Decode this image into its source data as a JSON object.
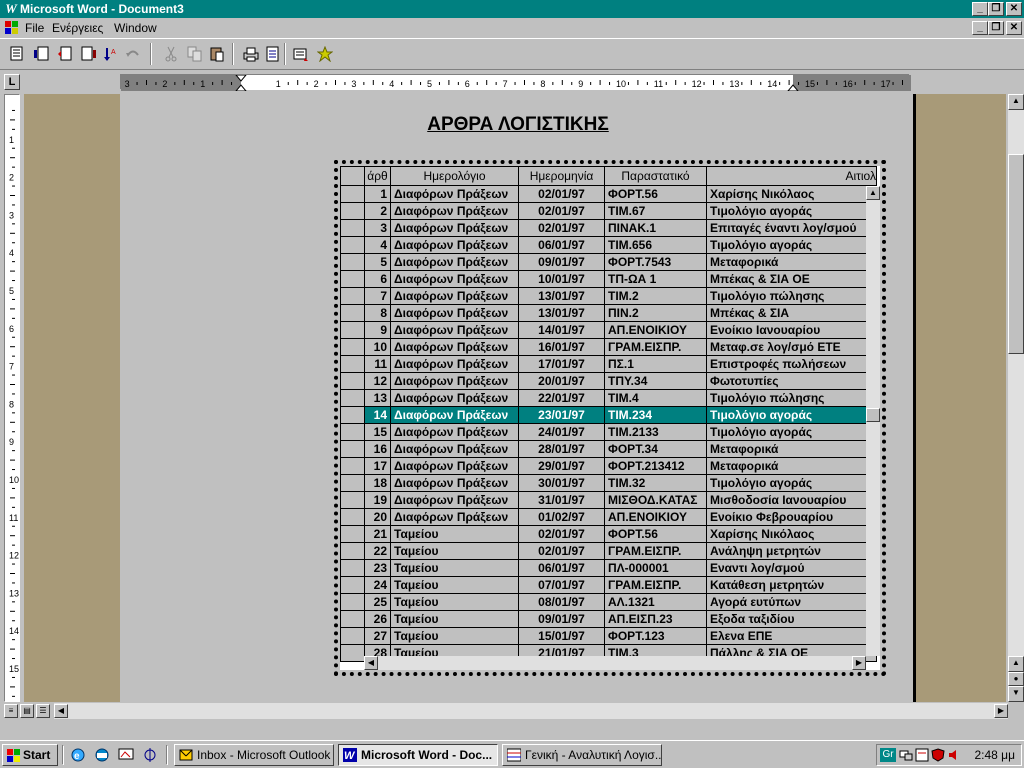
{
  "window": {
    "title": "Microsoft Word - Document3",
    "menu": [
      "File",
      "Ενέργειες",
      "Window"
    ]
  },
  "ruler": {
    "numbers": [
      "3",
      "2",
      "1",
      "1",
      "2",
      "3",
      "4",
      "5",
      "6",
      "7",
      "8",
      "9",
      "10",
      "11",
      "12",
      "13",
      "14",
      "15",
      "16",
      "17"
    ]
  },
  "document": {
    "title": "ΑΡΘΡΑ ΛΟΓΙΣΤΙΚΗΣ"
  },
  "grid": {
    "columns": [
      "άρθ",
      "Ημερολόγιο",
      "Ημερομηνία",
      "Παραστατικό",
      "Αιτιολ"
    ],
    "selected_row": 14,
    "rows": [
      {
        "n": "1",
        "journal": "Διαφόρων Πράξεων",
        "date": "02/01/97",
        "doc": "ΦΟΡΤ.56",
        "reason": "Χαρίσης Νικόλαος"
      },
      {
        "n": "2",
        "journal": "Διαφόρων Πράξεων",
        "date": "02/01/97",
        "doc": "ΤΙΜ.67",
        "reason": "Τιμολόγιο αγοράς"
      },
      {
        "n": "3",
        "journal": "Διαφόρων Πράξεων",
        "date": "02/01/97",
        "doc": "ΠΙΝΑΚ.1",
        "reason": "Επιταγές έναντι λογ/σμού"
      },
      {
        "n": "4",
        "journal": "Διαφόρων Πράξεων",
        "date": "06/01/97",
        "doc": "ΤΙΜ.656",
        "reason": "Τιμολόγιο αγοράς"
      },
      {
        "n": "5",
        "journal": "Διαφόρων Πράξεων",
        "date": "09/01/97",
        "doc": "ΦΟΡΤ.7543",
        "reason": "Μεταφορικά"
      },
      {
        "n": "6",
        "journal": "Διαφόρων Πράξεων",
        "date": "10/01/97",
        "doc": "ΤΠ-ΩΑ 1",
        "reason": "Μπέκας & ΣΙΑ ΟΕ"
      },
      {
        "n": "7",
        "journal": "Διαφόρων Πράξεων",
        "date": "13/01/97",
        "doc": "ΤΙΜ.2",
        "reason": "Τιμολόγιο πώλησης"
      },
      {
        "n": "8",
        "journal": "Διαφόρων Πράξεων",
        "date": "13/01/97",
        "doc": "ΠΙΝ.2",
        "reason": "Μπέκας & ΣΙΑ"
      },
      {
        "n": "9",
        "journal": "Διαφόρων Πράξεων",
        "date": "14/01/97",
        "doc": "ΑΠ.ΕΝΟΙΚΙΟΥ",
        "reason": "Ενοίκιο Ιανουαρίου"
      },
      {
        "n": "10",
        "journal": "Διαφόρων Πράξεων",
        "date": "16/01/97",
        "doc": "ΓΡΑΜ.ΕΙΣΠΡ.",
        "reason": "Μεταφ.σε λογ/σμό ΕΤΕ"
      },
      {
        "n": "11",
        "journal": "Διαφόρων Πράξεων",
        "date": "17/01/97",
        "doc": "ΠΣ.1",
        "reason": "Επιστροφές πωλήσεων"
      },
      {
        "n": "12",
        "journal": "Διαφόρων Πράξεων",
        "date": "20/01/97",
        "doc": "ΤΠΥ.34",
        "reason": "Φωτοτυπίες"
      },
      {
        "n": "13",
        "journal": "Διαφόρων Πράξεων",
        "date": "22/01/97",
        "doc": "ΤΙΜ.4",
        "reason": "Τιμολόγιο πώλησης"
      },
      {
        "n": "14",
        "journal": "Διαφόρων Πράξεων",
        "date": "23/01/97",
        "doc": "ΤΙΜ.234",
        "reason": "Τιμολόγιο αγοράς"
      },
      {
        "n": "15",
        "journal": "Διαφόρων Πράξεων",
        "date": "24/01/97",
        "doc": "ΤΙΜ.2133",
        "reason": "Τιμολόγιο αγοράς"
      },
      {
        "n": "16",
        "journal": "Διαφόρων Πράξεων",
        "date": "28/01/97",
        "doc": "ΦΟΡΤ.34",
        "reason": "Μεταφορικά"
      },
      {
        "n": "17",
        "journal": "Διαφόρων Πράξεων",
        "date": "29/01/97",
        "doc": "ΦΟΡΤ.213412",
        "reason": "Μεταφορικά"
      },
      {
        "n": "18",
        "journal": "Διαφόρων Πράξεων",
        "date": "30/01/97",
        "doc": "ΤΙΜ.32",
        "reason": "Τιμολόγιο αγοράς"
      },
      {
        "n": "19",
        "journal": "Διαφόρων Πράξεων",
        "date": "31/01/97",
        "doc": "ΜΙΣΘΟΔ.ΚΑΤΑΣ",
        "reason": "Μισθοδοσία Ιανουαρίου"
      },
      {
        "n": "20",
        "journal": "Διαφόρων Πράξεων",
        "date": "01/02/97",
        "doc": "ΑΠ.ΕΝΟΙΚΙΟΥ",
        "reason": "Ενοίκιο Φεβρουαρίου"
      },
      {
        "n": "21",
        "journal": "Ταμείου",
        "date": "02/01/97",
        "doc": "ΦΟΡΤ.56",
        "reason": "Χαρίσης Νικόλαος"
      },
      {
        "n": "22",
        "journal": "Ταμείου",
        "date": "02/01/97",
        "doc": "ΓΡΑΜ.ΕΙΣΠΡ.",
        "reason": "Ανάληψη μετρητών"
      },
      {
        "n": "23",
        "journal": "Ταμείου",
        "date": "06/01/97",
        "doc": "ΠΛ-000001",
        "reason": "Εναντι λογ/σμού"
      },
      {
        "n": "24",
        "journal": "Ταμείου",
        "date": "07/01/97",
        "doc": "ΓΡΑΜ.ΕΙΣΠΡ.",
        "reason": "Κατάθεση μετρητών"
      },
      {
        "n": "25",
        "journal": "Ταμείου",
        "date": "08/01/97",
        "doc": "ΑΛ.1321",
        "reason": "Αγορά ευτύπων"
      },
      {
        "n": "26",
        "journal": "Ταμείου",
        "date": "09/01/97",
        "doc": "ΑΠ.ΕΙΣΠ.23",
        "reason": "Εξοδα ταξιδίου"
      },
      {
        "n": "27",
        "journal": "Ταμείου",
        "date": "15/01/97",
        "doc": "ΦΟΡΤ.123",
        "reason": "Ελενα ΕΠΕ"
      },
      {
        "n": "28",
        "journal": "Ταμείου",
        "date": "21/01/97",
        "doc": "ΤΙΜ.3",
        "reason": "Πάλλης & ΣΙΑ ΟΕ"
      }
    ]
  },
  "taskbar": {
    "start": "Start",
    "tasks": [
      {
        "label": "Inbox - Microsoft Outlook",
        "active": false
      },
      {
        "label": "Microsoft Word - Doc...",
        "active": true
      },
      {
        "label": "Γενική - Αναλυτική Λογισ...",
        "active": false
      }
    ],
    "clock": "2:48 μμ",
    "tray_lang": "Gr"
  },
  "colors": {
    "titlebar": "#008080",
    "highlight": "#008080",
    "desktop_gray": "#c0c0c0",
    "doc_background": "#a89a78"
  }
}
